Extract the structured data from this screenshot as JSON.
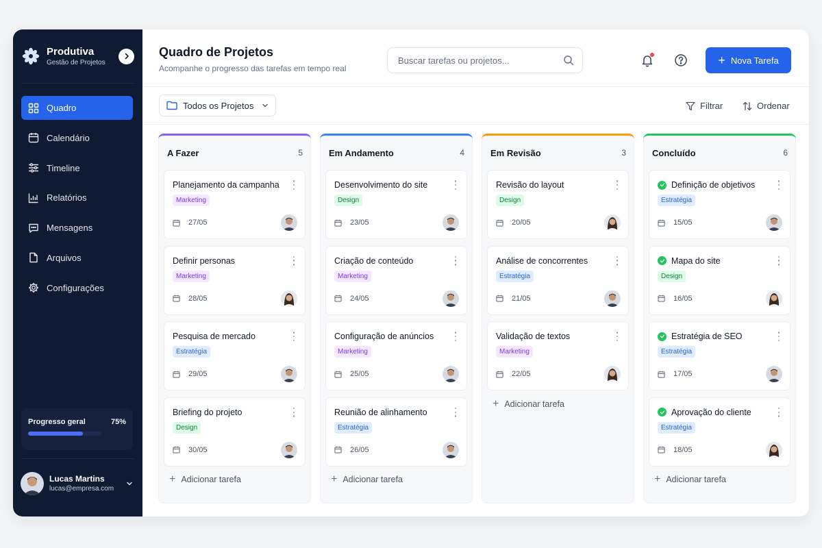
{
  "brand": {
    "name": "Produtiva",
    "subtitle": "Gestão de Projetos"
  },
  "sidebar": {
    "items": [
      {
        "label": "Quadro",
        "icon": "grid-icon",
        "active": true
      },
      {
        "label": "Calendário",
        "icon": "calendar-icon"
      },
      {
        "label": "Timeline",
        "icon": "sliders-icon"
      },
      {
        "label": "Relatórios",
        "icon": "chart-icon"
      },
      {
        "label": "Mensagens",
        "icon": "message-icon"
      },
      {
        "label": "Arquivos",
        "icon": "file-icon"
      },
      {
        "label": "Configurações",
        "icon": "gear-icon"
      }
    ],
    "progress": {
      "label": "Progresso geral",
      "value_text": "75%",
      "value": 0.75
    }
  },
  "user": {
    "name": "Lucas Martins",
    "email": "lucas@empresa.com"
  },
  "header": {
    "title": "Quadro de Projetos",
    "subtitle": "Acompanhe o progresso das tarefas em tempo real",
    "search_placeholder": "Buscar tarefas ou projetos...",
    "new_task_label": "Nova Tarefa"
  },
  "toolbar": {
    "project_filter": "Todos os Projetos",
    "filter_label": "Filtrar",
    "sort_label": "Ordenar"
  },
  "colors": {
    "accent": "#2563eb",
    "col_todo": "#8b5cf6",
    "col_progress": "#3b82f6",
    "col_review": "#f59e0b",
    "col_done": "#22c55e"
  },
  "board": {
    "add_task_label": "Adicionar tarefa",
    "columns": [
      {
        "title": "A Fazer",
        "count": "5",
        "cards": [
          {
            "title": "Planejamento da campanha",
            "tag": "Marketing",
            "date": "27/05"
          },
          {
            "title": "Definir personas",
            "tag": "Marketing",
            "date": "28/05"
          },
          {
            "title": "Pesquisa de mercado",
            "tag": "Estratégia",
            "date": "29/05"
          },
          {
            "title": "Briefing do projeto",
            "tag": "Design",
            "date": "30/05"
          }
        ]
      },
      {
        "title": "Em Andamento",
        "count": "4",
        "cards": [
          {
            "title": "Desenvolvimento do site",
            "tag": "Design",
            "date": "23/05"
          },
          {
            "title": "Criação de conteúdo",
            "tag": "Marketing",
            "date": "24/05"
          },
          {
            "title": "Configuração de anúncios",
            "tag": "Marketing",
            "date": "25/05"
          },
          {
            "title": "Reunião de alinhamento",
            "tag": "Estratégia",
            "date": "26/05"
          }
        ]
      },
      {
        "title": "Em Revisão",
        "count": "3",
        "cards": [
          {
            "title": "Revisão do layout",
            "tag": "Design",
            "date": "20/05"
          },
          {
            "title": "Análise de concorrentes",
            "tag": "Estratégia",
            "date": "21/05"
          },
          {
            "title": "Validação de textos",
            "tag": "Marketing",
            "date": "22/05"
          }
        ]
      },
      {
        "title": "Concluído",
        "count": "6",
        "cards": [
          {
            "title": "Definição de objetivos",
            "tag": "Estratégia",
            "date": "15/05"
          },
          {
            "title": "Mapa do site",
            "tag": "Design",
            "date": "16/05"
          },
          {
            "title": "Estratégia de SEO",
            "tag": "Estratégia",
            "date": "17/05"
          },
          {
            "title": "Aprovação do cliente",
            "tag": "Estratégia",
            "date": "18/05"
          }
        ]
      }
    ]
  }
}
